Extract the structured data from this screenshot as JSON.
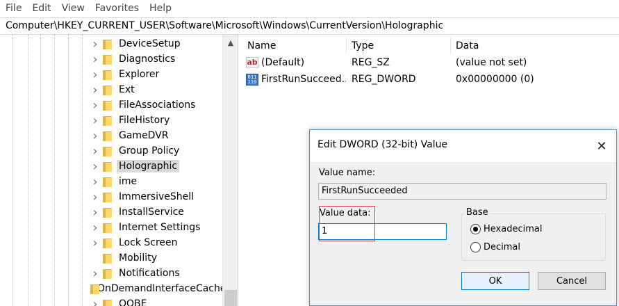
{
  "menu": [
    "File",
    "Edit",
    "View",
    "Favorites",
    "Help"
  ],
  "address": "Computer\\HKEY_CURRENT_USER\\Software\\Microsoft\\Windows\\CurrentVersion\\Holographic",
  "tree": {
    "items": [
      {
        "label": "DeviceSetup",
        "expandable": true
      },
      {
        "label": "Diagnostics",
        "expandable": true
      },
      {
        "label": "Explorer",
        "expandable": true
      },
      {
        "label": "Ext",
        "expandable": true
      },
      {
        "label": "FileAssociations",
        "expandable": true
      },
      {
        "label": "FileHistory",
        "expandable": true
      },
      {
        "label": "GameDVR",
        "expandable": true
      },
      {
        "label": "Group Policy",
        "expandable": true
      },
      {
        "label": "Holographic",
        "expandable": true,
        "selected": true
      },
      {
        "label": "ime",
        "expandable": true
      },
      {
        "label": "ImmersiveShell",
        "expandable": true
      },
      {
        "label": "InstallService",
        "expandable": true
      },
      {
        "label": "Internet Settings",
        "expandable": true
      },
      {
        "label": "Lock Screen",
        "expandable": true
      },
      {
        "label": "Mobility",
        "expandable": false
      },
      {
        "label": "Notifications",
        "expandable": true
      },
      {
        "label": "OnDemandInterfaceCache",
        "expandable": false
      },
      {
        "label": "OOBE",
        "expandable": true
      }
    ],
    "scroll_up_icon": "chevron-up-icon"
  },
  "values_pane": {
    "headers": {
      "name": "Name",
      "type": "Type",
      "data": "Data"
    },
    "rows": [
      {
        "icon": "string-value-icon",
        "name": "(Default)",
        "type": "REG_SZ",
        "data": "(value not set)"
      },
      {
        "icon": "binary-value-icon",
        "name": "FirstRunSucceed...",
        "type": "REG_DWORD",
        "data": "0x00000000 (0)"
      }
    ]
  },
  "dialog": {
    "title": "Edit DWORD (32-bit) Value",
    "value_name_label": "Value name:",
    "value_name": "FirstRunSucceeded",
    "value_data_label": "Value data:",
    "value_data": "1",
    "base_label": "Base",
    "radio_hex": "Hexadecimal",
    "radio_dec": "Decimal",
    "selected_base": "Hexadecimal",
    "ok": "OK",
    "cancel": "Cancel",
    "highlight_color": "#e03a3a"
  }
}
